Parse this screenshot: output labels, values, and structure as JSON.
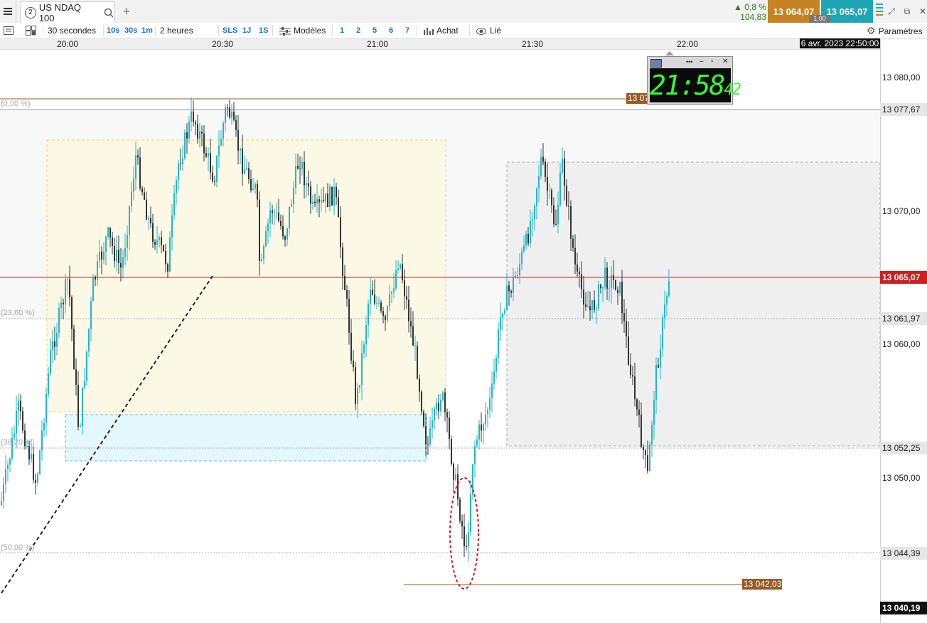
{
  "tab": {
    "number": "2",
    "title": "US NDAQ 100"
  },
  "quote": {
    "change_pct": "▲ 0,8 %",
    "change_abs": "104,83",
    "bid": "13 064,07",
    "ask": "13 065,07",
    "spread": "1,00"
  },
  "toolbar": {
    "timeframe": "30 secondes",
    "quick_tf": [
      "10s",
      "30s",
      "1m"
    ],
    "span": "2 heures",
    "quick_span": [
      "SLS",
      "1J",
      "1S"
    ],
    "models": "Modèles",
    "count_buttons": [
      "1",
      "2",
      "5",
      "6",
      "7"
    ],
    "buy": "Achat",
    "linked": "Lié",
    "settings": "Paramètres"
  },
  "time_axis": [
    "20:00",
    "20:30",
    "21:00",
    "21:30",
    "22:00"
  ],
  "datetime": "6 avr. 2023 22:50:00",
  "price_axis": [
    "13 080,00",
    "13 070,00",
    "13 060,00",
    "13 050,00"
  ],
  "price_markers": {
    "fib0": "13 077,67",
    "current": "13 065,07",
    "fib236": "13 061,97",
    "fib382": "13 052,25",
    "fib50": "13 044,39",
    "low_line": "13 042,03",
    "bottom": "13 040,19",
    "high_label": "13 07"
  },
  "fib_labels": [
    "(0,00 %)",
    "(23,60 %)",
    "(38,20 %)",
    "(50,00 %)"
  ],
  "clock": {
    "time": "21:58",
    "seconds": "42"
  },
  "colors": {
    "up": "#20b7c8",
    "down": "#333333",
    "current_line": "#cc1f1f",
    "bid": "#c58322",
    "ask": "#1fa6b5",
    "low_line": "#9a5a24"
  },
  "chart_data": {
    "type": "candlestick",
    "symbol": "US NDAQ 100",
    "interval": "30 secondes",
    "ylim": [
      13039,
      13084
    ]
  }
}
